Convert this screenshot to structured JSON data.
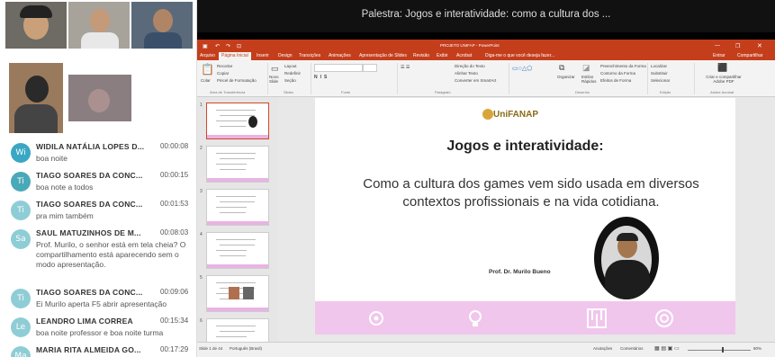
{
  "presentation_title": "Palestra: Jogos e interatividade: como a cultura dos ...",
  "chat": [
    {
      "initials": "Wi",
      "color": "#3aa7c4",
      "name": "WIDILA NATÁLIA LOPES D...",
      "time": "00:00:08",
      "message": "boa noite"
    },
    {
      "initials": "Ti",
      "color": "#4aa9b8",
      "name": "TIAGO SOARES DA CONC...",
      "time": "00:00:15",
      "message": "boa note a todos"
    },
    {
      "initials": "Ti",
      "color": "#8fcdd6",
      "name": "TIAGO SOARES DA CONC...",
      "time": "00:01:53",
      "message": "pra mim também"
    },
    {
      "initials": "Sa",
      "color": "#8fcdd6",
      "name": "SAUL MATUZINHOS DE M...",
      "time": "00:08:03",
      "message": "Prof. Murilo, o senhor está em tela cheia? O compartilhamento está aparecendo sem o modo apresentação."
    },
    {
      "initials": "Ti",
      "color": "#8fcdd6",
      "name": "TIAGO SOARES DA CONC...",
      "time": "00:09:06",
      "message": "Ei Murilo aperta F5 abrir apresentação"
    },
    {
      "initials": "Le",
      "color": "#8fcdd6",
      "name": "LEANDRO LIMA CORREA",
      "time": "00:15:34",
      "message": "boa noite professor e boa noite turma"
    },
    {
      "initials": "Ma",
      "color": "#8fcdd6",
      "name": "MARIA RITA ALMEIDA GO...",
      "time": "00:17:29",
      "message": ""
    }
  ],
  "powerpoint": {
    "window_title": "PROJETO UNIFAP - PowerPoint",
    "tabs": [
      "Arquivo",
      "Página Inicial",
      "Inserir",
      "Design",
      "Transições",
      "Animações",
      "Apresentação de Slides",
      "Revisão",
      "Exibir",
      "Acrobat",
      "Diga-me o que você deseja fazer..."
    ],
    "account": "Entrar",
    "share": "Compartilhar",
    "ribbon": {
      "paste": "Colar",
      "cut": "Recortar",
      "copy": "Copiar",
      "format_painter": "Pincel de Formatação",
      "new_slide": "Novo Slide",
      "layout": "Layout",
      "reset": "Redefinir",
      "section": "Seção",
      "organize": "Organizar",
      "quick_styles": "Estilos Rápidos",
      "text_direction": "Direção do Texto",
      "align_text": "Alinhar Texto",
      "convert_smartart": "Converter em SmartArt",
      "shape_fill": "Preenchimento da Forma",
      "shape_outline": "Contorno da Forma",
      "shape_effects": "Efeitos de Forma",
      "find": "Localizar",
      "replace": "Substituir",
      "select": "Selecionar",
      "adobe": "Criar e compartilhar Adobe PDF",
      "groups": [
        "Área de Transferência",
        "Slides",
        "Fonte",
        "Parágrafo",
        "Desenho",
        "Edição",
        "Adobe Acrobat"
      ]
    },
    "slide_numbers": [
      "1",
      "2",
      "3",
      "4",
      "5",
      "6"
    ],
    "status": {
      "slide": "Slide 1 de 44",
      "language": "Português (Brasil)",
      "notes": "Anotações",
      "comments": "Comentários",
      "zoom": "80%"
    },
    "slide": {
      "logo": "UniFANAP",
      "heading": "Jogos e interatividade:",
      "body": "Como a cultura dos games vem sido usada em diversos contextos profissionais e na vida cotidiana.",
      "author": "Prof. Dr. Murilo Bueno"
    }
  }
}
